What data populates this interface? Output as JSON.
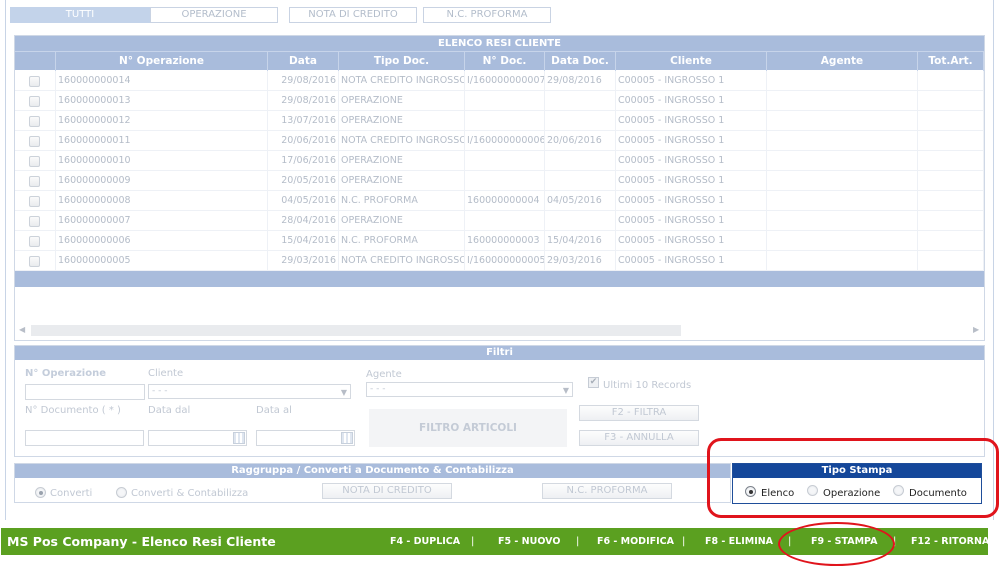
{
  "tabs": [
    {
      "label": "TUTTI",
      "active": true
    },
    {
      "label": "OPERAZIONE",
      "active": false
    },
    {
      "label": "NOTA DI CREDITO",
      "active": false
    },
    {
      "label": "N.C. PROFORMA",
      "active": false
    }
  ],
  "grid": {
    "title": "ELENCO RESI CLIENTE",
    "columns": [
      "",
      "N° Operazione",
      "Data",
      "Tipo Doc.",
      "N° Doc.",
      "Data Doc.",
      "Cliente",
      "Agente",
      "Tot.Art."
    ],
    "rows": [
      [
        "160000000014",
        "29/08/2016",
        "NOTA CREDITO INGROSSO",
        "I/160000000007",
        "29/08/2016",
        "C00005 - INGROSSO 1",
        "",
        ""
      ],
      [
        "160000000013",
        "29/08/2016",
        "OPERAZIONE",
        "",
        "",
        "C00005 - INGROSSO 1",
        "",
        ""
      ],
      [
        "160000000012",
        "13/07/2016",
        "OPERAZIONE",
        "",
        "",
        "C00005 - INGROSSO 1",
        "",
        ""
      ],
      [
        "160000000011",
        "20/06/2016",
        "NOTA CREDITO INGROSSO",
        "I/160000000006",
        "20/06/2016",
        "C00005 - INGROSSO 1",
        "",
        ""
      ],
      [
        "160000000010",
        "17/06/2016",
        "OPERAZIONE",
        "",
        "",
        "C00005 - INGROSSO 1",
        "",
        ""
      ],
      [
        "160000000009",
        "20/05/2016",
        "OPERAZIONE",
        "",
        "",
        "C00005 - INGROSSO 1",
        "",
        ""
      ],
      [
        "160000000008",
        "04/05/2016",
        "N.C. PROFORMA",
        "160000000004",
        "04/05/2016",
        "C00005 - INGROSSO 1",
        "",
        ""
      ],
      [
        "160000000007",
        "28/04/2016",
        "OPERAZIONE",
        "",
        "",
        "C00005 - INGROSSO 1",
        "",
        ""
      ],
      [
        "160000000006",
        "15/04/2016",
        "N.C. PROFORMA",
        "160000000003",
        "15/04/2016",
        "C00005 - INGROSSO 1",
        "",
        ""
      ],
      [
        "160000000005",
        "29/03/2016",
        "NOTA CREDITO INGROSSO",
        "I/160000000005",
        "29/03/2016",
        "C00005 - INGROSSO 1",
        "",
        ""
      ]
    ]
  },
  "filters": {
    "title": "Filtri",
    "operazione_label": "N° Operazione",
    "cliente_label": "Cliente",
    "cliente_value": "- - -",
    "agente_label": "Agente",
    "agente_value": "- - -",
    "ultimi_label": "Ultimi 10 Records",
    "documento_label": "N° Documento ( * )",
    "data_dal_label": "Data dal",
    "data_al_label": "Data al",
    "filtro_articoli": "FILTRO ARTICOLI",
    "filtra_button": "F2 - FILTRA",
    "annulla_button": "F3 - ANNULLA"
  },
  "raggruppa": {
    "title": "Raggruppa / Converti a Documento & Contabilizza",
    "converti": "Converti",
    "converti_contabilizza": "Converti & Contabilizza",
    "nota_button": "NOTA DI CREDITO",
    "proforma_button": "N.C. PROFORMA"
  },
  "tipo_stampa": {
    "title": "Tipo Stampa",
    "options": [
      "Elenco",
      "Operazione",
      "Documento"
    ],
    "selected": "Elenco"
  },
  "statusbar": {
    "app_title": "MS Pos Company - Elenco Resi Cliente",
    "keys": [
      "F4 - DUPLICA",
      "F5 - NUOVO",
      "F6 - MODIFICA",
      "F8 - ELIMINA",
      "F9 - STAMPA",
      "F12 - RITORNA"
    ]
  },
  "colors": {
    "header_blue": "#a9bcdc",
    "tipo_blue": "#14479a",
    "status_green": "#5ba020",
    "annotation_red": "#e0141c"
  }
}
